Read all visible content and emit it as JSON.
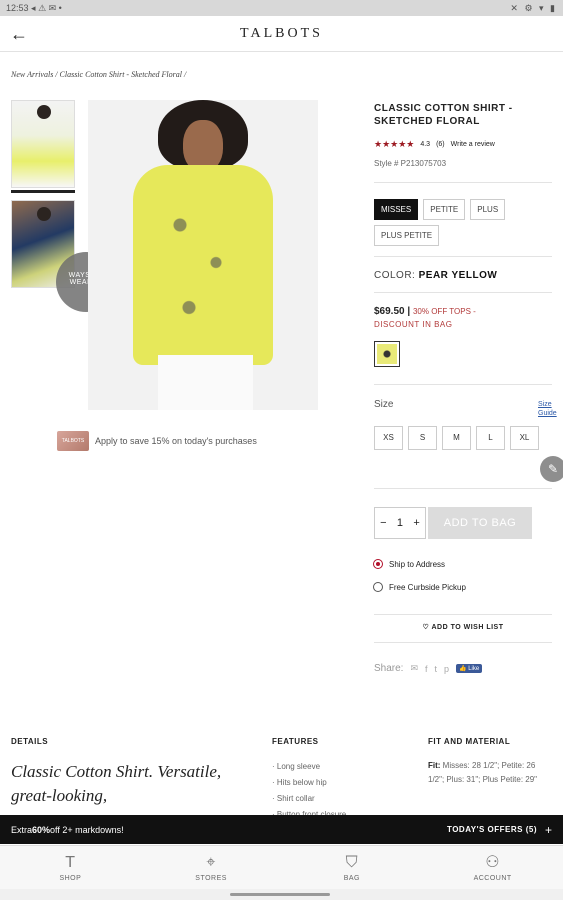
{
  "status": {
    "time": "12:53",
    "icons": "◂ ⚠ ✉ •",
    "right": "✕ ⚙ ▾ ▮"
  },
  "appbar": {
    "back_icon": "←",
    "logo": "TALBOTS"
  },
  "breadcrumb": {
    "text": "New Arrivals  /  Classic Cotton Shirt - Sketched Floral  /"
  },
  "gallery": {
    "ways_label": "WAYS TO WEAR IT"
  },
  "promo": {
    "card_text": "TALBOTS",
    "text": "Apply to save 15% on today's purchases"
  },
  "product": {
    "title": "CLASSIC COTTON SHIRT - SKETCHED FLORAL",
    "stars": "★★★★★",
    "rating": "4.3",
    "review_count": "(6)",
    "write_review": "Write a review",
    "style": "Style # P213075703",
    "fit_options": [
      "MISSES",
      "PETITE",
      "PLUS",
      "PLUS PETITE"
    ],
    "color_label": "COLOR:",
    "color_value": "PEAR YELLOW",
    "price": "$69.50",
    "separator": "|",
    "price_off": "30% OFF TOPS -",
    "discount_note": "DISCOUNT IN BAG",
    "size_label": "Size",
    "size_guide": "Size Guide",
    "sizes": [
      "XS",
      "S",
      "M",
      "L",
      "XL"
    ],
    "qty": "1",
    "qty_minus": "−",
    "qty_plus": "+",
    "add_to_bag": "ADD TO BAG",
    "ship_to_address": "Ship to Address",
    "curbside": "Free Curbside Pickup",
    "wish_list": "ADD TO WISH LIST",
    "share_label": "Share:",
    "fb_like": "👍 Like"
  },
  "details": {
    "details_h": "DETAILS",
    "features_h": "FEATURES",
    "fit_h": "FIT AND MATERIAL",
    "details_text": "Classic Cotton Shirt. Versatile, great-looking,",
    "features": [
      "· Long sleeve",
      "· Hits below hip",
      "· Shirt collar",
      "· Button front closure"
    ],
    "fit_label": "Fit:",
    "fit_text": " Misses: 28 1/2\"; Petite: 26 1/2\"; Plus: 31\"; Plus Petite: 29\""
  },
  "offers": {
    "left_prefix": "Extra ",
    "left_bold": "60%",
    "left_suffix": " off 2+ markdowns!",
    "right": "TODAY'S OFFERS (5)",
    "plus": "+"
  },
  "tabs": [
    {
      "label": "SHOP",
      "icon": "T"
    },
    {
      "label": "STORES",
      "icon": "⌖"
    },
    {
      "label": "BAG",
      "icon": "⛉"
    },
    {
      "label": "ACCOUNT",
      "icon": "⚇"
    }
  ]
}
